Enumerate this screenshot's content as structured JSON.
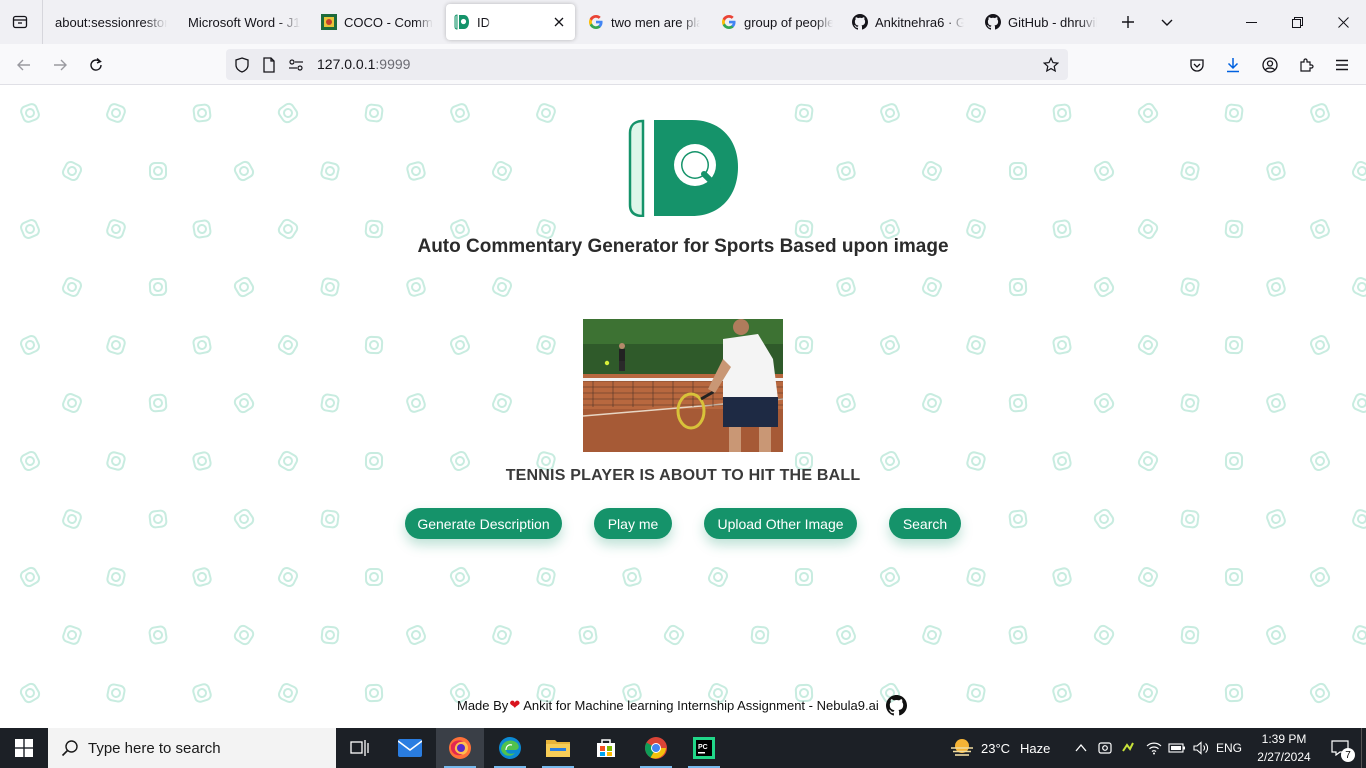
{
  "browser": {
    "tabs": [
      {
        "label": "about:sessionrestore",
        "favicon": "none"
      },
      {
        "label": "Microsoft Word - J1_",
        "favicon": "none"
      },
      {
        "label": "COCO - Commo",
        "favicon": "coco-icon"
      },
      {
        "label": "ID",
        "favicon": "id-logo-icon",
        "active": true
      },
      {
        "label": "two men are play",
        "favicon": "google-icon"
      },
      {
        "label": "group of people",
        "favicon": "google-icon"
      },
      {
        "label": "Ankitnehra6 · Git",
        "favicon": "github-icon"
      },
      {
        "label": "GitHub - dhruvik",
        "favicon": "github-icon"
      }
    ],
    "url_host": "127.0.0.1",
    "url_port": ":9999"
  },
  "page": {
    "title": "Auto Commentary Generator for Sports Based upon image",
    "caption": "TENNIS PLAYER IS ABOUT TO HIT THE BALL",
    "buttons": {
      "generate": "Generate Description",
      "play": "Play me",
      "upload": "Upload Other Image",
      "search": "Search"
    },
    "footer": {
      "made_by": "Made By",
      "rest": "Ankit for Machine learning Internship Assignment - Nebula9.ai"
    },
    "accent_color": "#15936a"
  },
  "taskbar": {
    "search_placeholder": "Type here to search",
    "weather_temp": "23°C",
    "weather_desc": "Haze",
    "language": "ENG",
    "time": "1:39 PM",
    "date": "2/27/2024",
    "notification_count": "7"
  }
}
